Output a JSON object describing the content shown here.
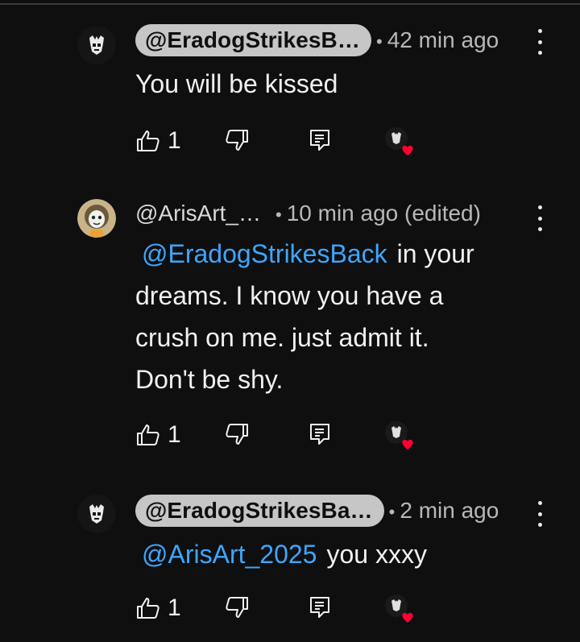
{
  "comments": [
    {
      "author": "@EradogStrikesB…",
      "time": "42 min ago",
      "highlighted_handle": true,
      "mention": "",
      "text": "You will be kissed",
      "likes": "1"
    },
    {
      "author": "@ArisArt_…",
      "time": "10 min ago (edited)",
      "highlighted_handle": false,
      "mention": "@EradogStrikesBack",
      "text_first": "in your",
      "text_lines": [
        "dreams. I know you have a",
        "crush on me. just admit it.",
        "Don't be shy."
      ],
      "likes": "1"
    },
    {
      "author": "@EradogStrikesBa…",
      "time": "2 min ago",
      "highlighted_handle": true,
      "mention": "@ArisArt_2025",
      "text": "you xxxy",
      "likes": "1"
    }
  ],
  "separator": "•",
  "icons": {
    "like": "thumbs-up-icon",
    "dislike": "thumbs-down-icon",
    "reply": "reply-icon",
    "more": "more-vert-icon",
    "creator_heart": "creator-heart-icon"
  },
  "colors": {
    "background": "#0f0f0f",
    "mention": "#3ea6ff",
    "pill": "#c6c6c6",
    "heart": "#ff0033"
  }
}
